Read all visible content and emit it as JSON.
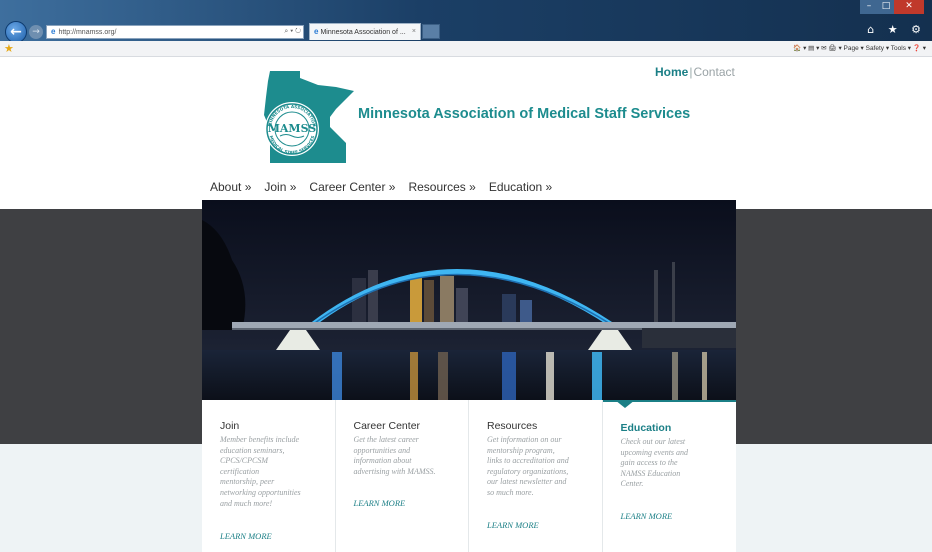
{
  "browser": {
    "url": "http://mnamss.org/",
    "address_tools": "⌕ ▾ ↻",
    "tab_title": "Minnesota Association of ...",
    "tab_close": "×",
    "back_glyph": "←",
    "forward_glyph": "→",
    "right_icons": "⌂ ★ ⚙",
    "command_bar": "🏠 ▾  ▤ ▾  ✉  🖨 ▾  Page ▾  Safety ▾  Tools ▾  ❓ ▾",
    "icons": [
      "back-arrow-icon",
      "forward-arrow-icon",
      "ie-logo-icon",
      "home-icon",
      "favorites-star-icon",
      "settings-gear-icon"
    ]
  },
  "header": {
    "home_link": "Home",
    "separator": "|",
    "contact_link": "Contact",
    "site_title": "Minnesota Association of Medical Staff Services",
    "logo": {
      "abbr": "MAMSS",
      "ring_top": "MINNESOTA ASSOCIATION",
      "ring_bottom": "MEDICAL STAFF SERVICES"
    }
  },
  "nav": {
    "items": [
      {
        "label": "About »"
      },
      {
        "label": "Join »"
      },
      {
        "label": "Career Center »"
      },
      {
        "label": "Resources »"
      },
      {
        "label": "Education »"
      }
    ]
  },
  "cards": [
    {
      "title": "Join",
      "description": "Member benefits include\neducation seminars,\nCPCS/CPCSM\ncertification\nmentorship, peer\nnetworking opportunities\nand much more!",
      "link": "LEARN MORE",
      "active": false
    },
    {
      "title": "Career Center",
      "description": "Get the latest career\nopportunities and\ninformation about\nadvertising with MAMSS.",
      "link": "LEARN MORE",
      "active": false
    },
    {
      "title": "Resources",
      "description": "Get information on our\nmentorship program,\nlinks to accreditation and\nregulatory organizations,\nour latest newsletter and\nso much more.",
      "link": "LEARN MORE",
      "active": false
    },
    {
      "title": "Education",
      "description": "Check out our latest\nupcoming events and\ngain access to the\nNAMSS Education\nCenter.",
      "link": "LEARN MORE",
      "active": true
    }
  ],
  "colors": {
    "brand_teal": "#1b7f86",
    "title_teal": "#1d8c8e",
    "dark_band": "#3f4043",
    "light_band": "#eef3f5"
  }
}
